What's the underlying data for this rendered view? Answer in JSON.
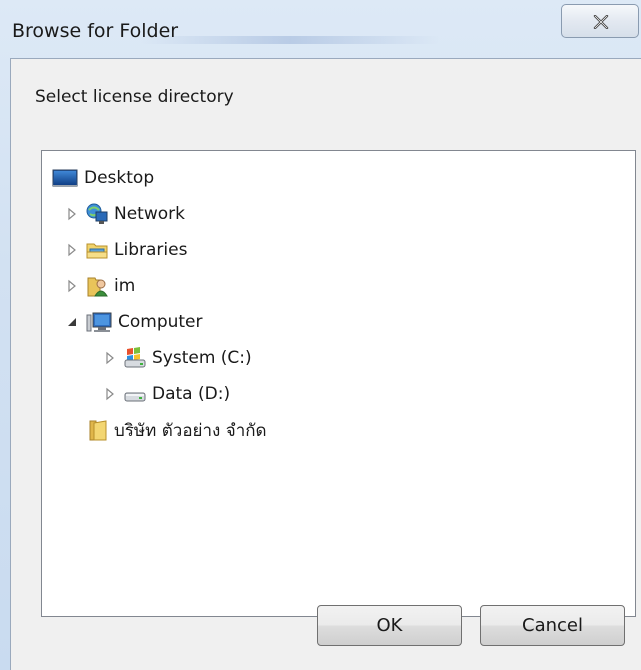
{
  "window": {
    "title": "Browse for Folder",
    "close_icon": "close-icon"
  },
  "dialog": {
    "instruction": "Select license directory"
  },
  "tree": {
    "items": [
      {
        "label": "Desktop",
        "icon": "desktop-icon",
        "expander": "none"
      },
      {
        "label": "Network",
        "icon": "network-icon",
        "expander": "collapsed"
      },
      {
        "label": "Libraries",
        "icon": "libraries-icon",
        "expander": "collapsed"
      },
      {
        "label": "im",
        "icon": "user-folder-icon",
        "expander": "collapsed"
      },
      {
        "label": "Computer",
        "icon": "computer-icon",
        "expander": "expanded"
      },
      {
        "label": "System (C:)",
        "icon": "system-drive-icon",
        "expander": "collapsed"
      },
      {
        "label": "Data (D:)",
        "icon": "drive-icon",
        "expander": "collapsed"
      },
      {
        "label": "บริษัท ตัวอย่าง จำกัด",
        "icon": "folder-icon",
        "expander": "none"
      }
    ]
  },
  "buttons": {
    "ok": "OK",
    "cancel": "Cancel"
  },
  "colors": {
    "titlebar": "#d2e1f2",
    "client": "#f0f0f0",
    "tree_background": "#ffffff"
  }
}
